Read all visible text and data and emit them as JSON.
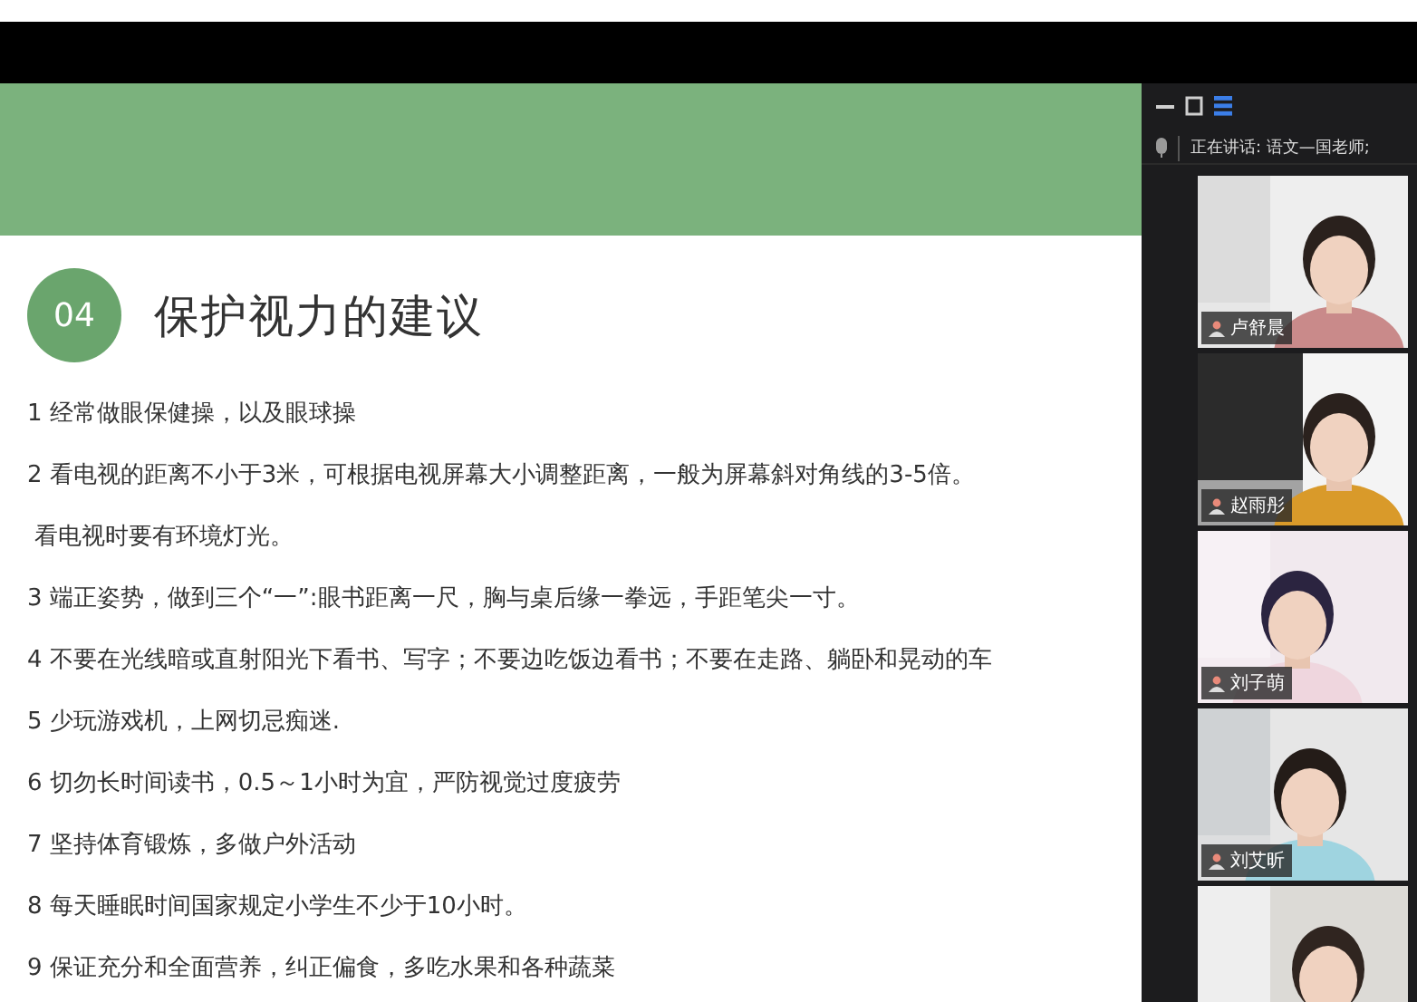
{
  "speaking": {
    "label": "正在讲话: 语文—国老师;"
  },
  "slide": {
    "badge": "04",
    "title": "保护视力的建议",
    "items": [
      "1 经常做眼保健操，以及眼球操",
      "2 看电视的距离不小于3米，可根据电视屏幕大小调整距离，一般为屏幕斜对角线的3-5倍。",
      " 看电视时要有环境灯光。",
      "3 端正姿势，做到三个“一”:眼书距离一尺，胸与桌后缘一拳远，手距笔尖一寸。",
      "4 不要在光线暗或直射阳光下看书、写字；不要边吃饭边看书；不要在走路、躺卧和晃动的车",
      "5 少玩游戏机，上网切忌痴迷.",
      "6 切勿长时间读书，0.5～1小时为宜，严防视觉过度疲劳",
      "7 坚持体育锻炼，多做户外活动",
      "8 每天睡眠时间国家规定小学生不少于10小时。",
      "9 保证充分和全面营养，纠正偏食，多吃水果和各种蔬菜"
    ]
  },
  "participants": [
    {
      "name": "卢舒晨",
      "kind": "picture"
    },
    {
      "name": "赵雨彤",
      "kind": "picture"
    },
    {
      "name": "刘子萌",
      "kind": "picture"
    },
    {
      "name": "刘艾昕",
      "kind": "picture"
    },
    {
      "kind": "picture"
    }
  ]
}
